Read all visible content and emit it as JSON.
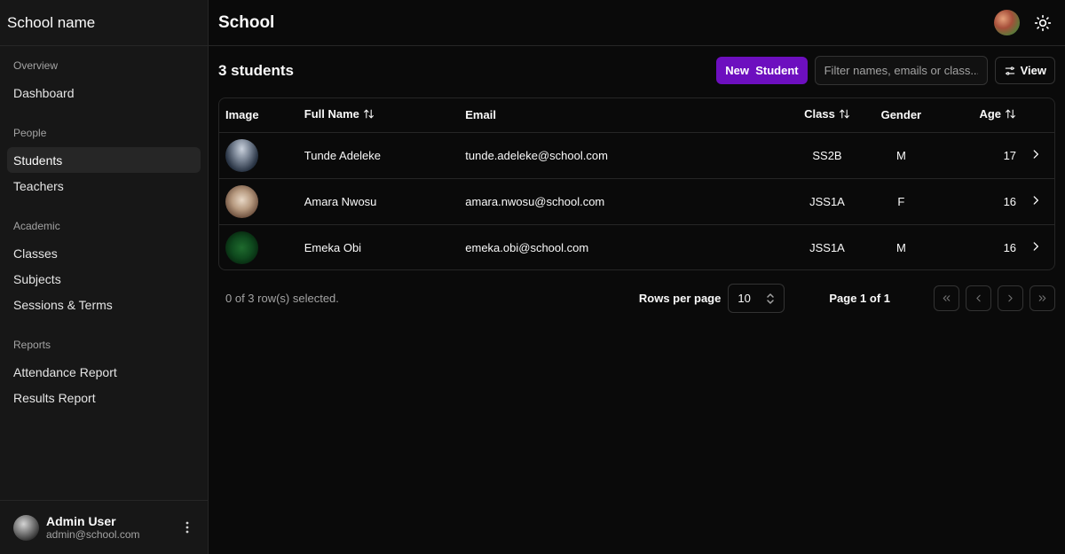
{
  "sidebar": {
    "school_name": "School name",
    "groups": [
      {
        "label": "Overview",
        "items": [
          {
            "label": "Dashboard"
          }
        ]
      },
      {
        "label": "People",
        "items": [
          {
            "label": "Students"
          },
          {
            "label": "Teachers"
          }
        ]
      },
      {
        "label": "Academic",
        "items": [
          {
            "label": "Classes"
          },
          {
            "label": "Subjects"
          },
          {
            "label": "Sessions & Terms"
          }
        ]
      },
      {
        "label": "Reports",
        "items": [
          {
            "label": "Attendance Report"
          },
          {
            "label": "Results Report"
          }
        ]
      }
    ],
    "active_item": "Students",
    "user": {
      "name": "Admin User",
      "email": "admin@school.com"
    }
  },
  "header": {
    "title": "School"
  },
  "toolbar": {
    "count_title": "3 students",
    "new_button": "New  Student",
    "filter_placeholder": "Filter names, emails or class...",
    "view_button": "View"
  },
  "table": {
    "columns": {
      "image": "Image",
      "full_name": "Full Name",
      "email": "Email",
      "class": "Class",
      "gender": "Gender",
      "age": "Age"
    },
    "rows": [
      {
        "name": "Tunde Adeleke",
        "email": "tunde.adeleke@school.com",
        "class": "SS2B",
        "gender": "M",
        "age": "17"
      },
      {
        "name": "Amara Nwosu",
        "email": "amara.nwosu@school.com",
        "class": "JSS1A",
        "gender": "F",
        "age": "16"
      },
      {
        "name": "Emeka Obi",
        "email": "emeka.obi@school.com",
        "class": "JSS1A",
        "gender": "M",
        "age": "16"
      }
    ]
  },
  "pagination": {
    "selected_text": "0 of 3 row(s) selected.",
    "rows_per_page_label": "Rows per page",
    "rows_per_page_value": "10",
    "page_label": "Page 1 of 1"
  },
  "colors": {
    "accent": "#6d0fbf",
    "background": "#0a0a0a",
    "sidebar": "#171717"
  }
}
